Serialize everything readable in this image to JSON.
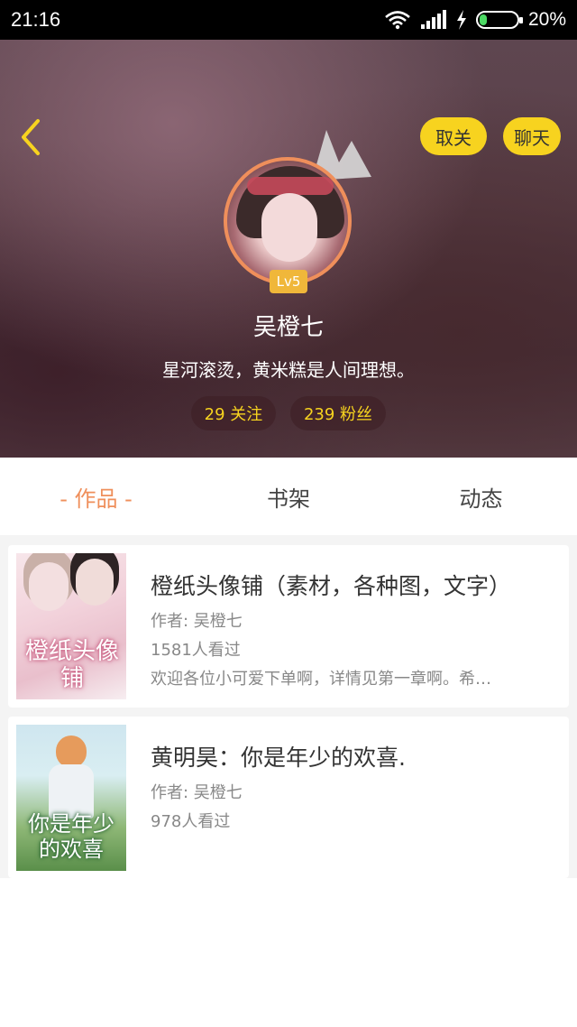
{
  "status_bar": {
    "time": "21:16",
    "battery": "20%",
    "battery_level": 0.2
  },
  "profile": {
    "unfollow_label": "取关",
    "chat_label": "聊天",
    "level": "Lv5",
    "username": "吴橙七",
    "bio": "星河滚烫，黄米糕是人间理想。",
    "following": "29 关注",
    "fans": "239 粉丝"
  },
  "tabs": {
    "works": "- 作品 -",
    "shelf": "书架",
    "feed": "动态"
  },
  "books": [
    {
      "title": "橙纸头像铺（素材，各种图，文字）",
      "author": "作者: 吴橙七",
      "views": "1581人看过",
      "desc": "欢迎各位小可爱下单啊，详情见第一章啊。希…",
      "cover_text": "橙纸头像铺"
    },
    {
      "title": "黄明昊：你是年少的欢喜.",
      "author": "作者: 吴橙七",
      "views": "978人看过",
      "cover_text": "你是年少的欢喜"
    }
  ],
  "colors": {
    "accent": "#ef8f5b",
    "yellow": "#f7d31f",
    "level": "#f0b73a"
  },
  "icons": {
    "back": "chevron-left-icon",
    "crown": "crown-icon",
    "wifi": "wifi-icon",
    "signal": "signal-icon",
    "charging": "lightning-icon",
    "battery": "battery-icon"
  }
}
